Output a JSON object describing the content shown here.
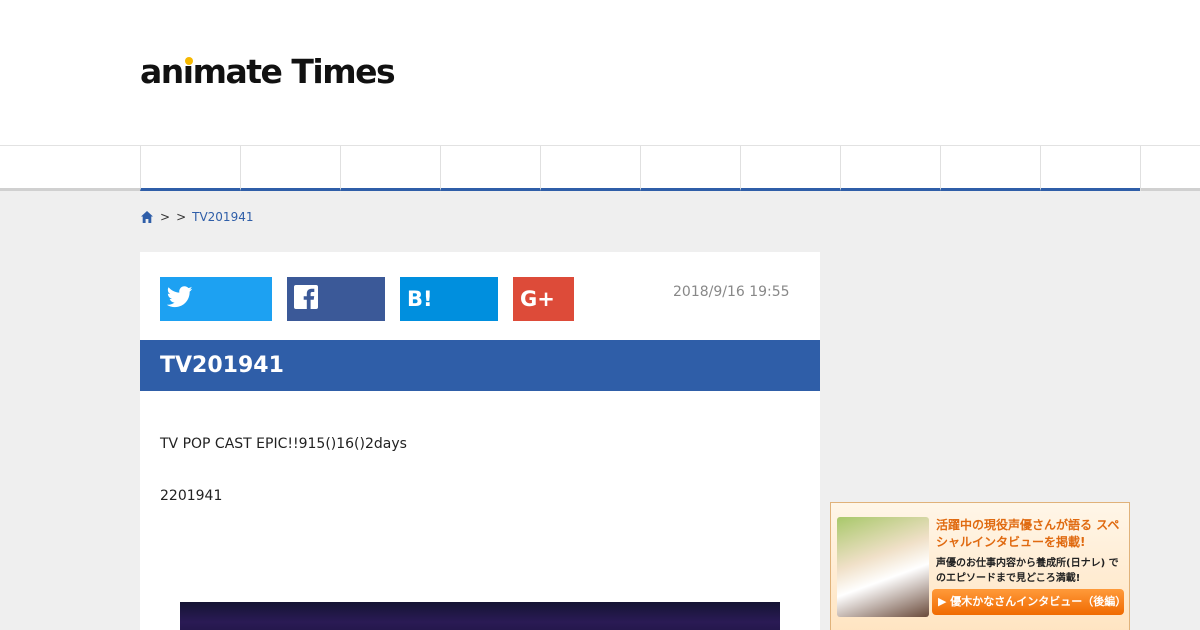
{
  "header": {
    "logo_pre": "an",
    "logo_i": "ı",
    "logo_post": "mate Times"
  },
  "nav": {
    "items": [
      "",
      "",
      "",
      "",
      "",
      "",
      "",
      "",
      "",
      "",
      ""
    ]
  },
  "breadcrumb": {
    "home_icon": "home-icon",
    "sep1": ">",
    "sep2": ">",
    "current": "TV201941"
  },
  "article": {
    "share": {
      "twitter_icon": "twitter-icon",
      "facebook_icon": "facebook-icon",
      "hatena_label": "B!",
      "googleplus_label": "G+"
    },
    "date": "2018/9/16 19:55",
    "title": "TV201941",
    "paragraphs": [
      "TV POP CAST EPIC!!915()16()2days",
      "2201941"
    ]
  },
  "ad": {
    "headline": "活躍中の現役声優さんが語る スペシャルインタビューを掲載!",
    "subtext": "声優のお仕事内容から養成所(日ナレ) でのエピソードまで見どころ満載!",
    "button_label": "▶ 優木かなさんインタビュー（後編）"
  },
  "colors": {
    "brand_blue": "#2f5ea8",
    "twitter": "#1da1f2",
    "facebook": "#3b5998",
    "hatena": "#008fde",
    "googleplus": "#dd4b39",
    "logo_dot": "#f6b800"
  }
}
